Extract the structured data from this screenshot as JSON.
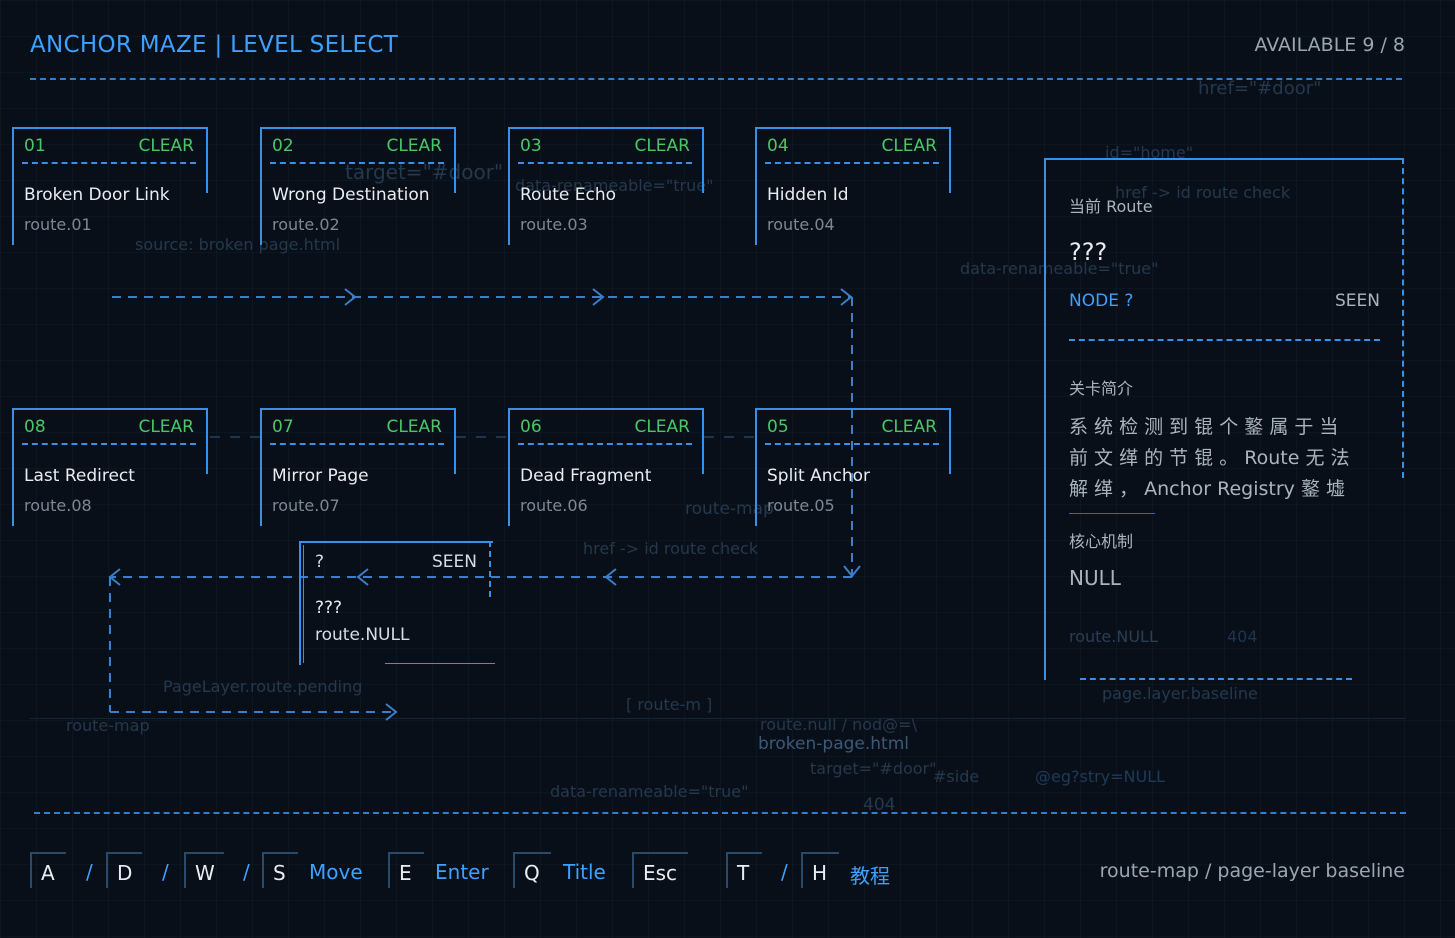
{
  "header": {
    "title": "ANCHOR MAZE | LEVEL SELECT",
    "available": "AVAILABLE 9 / 8"
  },
  "levels_top": [
    {
      "num": "01",
      "status": "CLEAR",
      "name": "Broken Door Link",
      "route": "route.01"
    },
    {
      "num": "02",
      "status": "CLEAR",
      "name": "Wrong Destination",
      "route": "route.02"
    },
    {
      "num": "03",
      "status": "CLEAR",
      "name": "Route Echo",
      "route": "route.03"
    },
    {
      "num": "04",
      "status": "CLEAR",
      "name": "Hidden Id",
      "route": "route.04"
    }
  ],
  "levels_bottom": [
    {
      "num": "08",
      "status": "CLEAR",
      "name": "Last Redirect",
      "route": "route.08"
    },
    {
      "num": "07",
      "status": "CLEAR",
      "name": "Mirror Page",
      "route": "route.07"
    },
    {
      "num": "06",
      "status": "CLEAR",
      "name": "Dead Fragment",
      "route": "route.06"
    },
    {
      "num": "05",
      "status": "CLEAR",
      "name": "Split Anchor",
      "route": "route.05"
    }
  ],
  "hidden_node": {
    "num": "?",
    "status": "SEEN",
    "name": "???",
    "route": "route.NULL"
  },
  "panel": {
    "current_label": "当前 Route",
    "current_value": "???",
    "node": "NODE ?",
    "node_status": "SEEN",
    "intro_label": "关卡简介",
    "intro_line1": "系 统 检 测 到 锟 个 鐜 属 于 当",
    "intro_line2": "前 文 缂 的 节 锟 。 Route 无 法",
    "intro_line3": "解 缂 ， Anchor Registry 鐜 墟",
    "mech_label": "核心机制",
    "mech_value": "NULL",
    "route_ghost": "route.NULL",
    "code_ghost": "404"
  },
  "ghost_text": {
    "g1": "href=\"#door\"",
    "g2": "id=\"home\"",
    "g3": "href -> id route check",
    "g4": "target=\"#door\"",
    "g5": "data-renameable=\"true\"",
    "g6": "source: broken page.html",
    "g7": "data-renameable=\"true\"",
    "g8": "route-map",
    "g9": "href -> id route check",
    "g10": "PageLayer.route.pending",
    "g11": "route-map",
    "g12": "[ route-m ]",
    "g13": "route.null / nod@=\\",
    "g14": "broken-page.html",
    "g15": "target=\"#door\"",
    "g16": "#side",
    "g17": "@eg?stry=NULL",
    "g18": "data-renameable=\"true\"",
    "g19": "404",
    "g20": "page.layer.baseline"
  },
  "controls": {
    "key_a": "A",
    "key_d": "D",
    "key_w": "W",
    "key_s": "S",
    "sep": "/",
    "move": "Move",
    "key_e": "E",
    "enter": "Enter",
    "key_q": "Q",
    "title": "Title",
    "key_esc": "Esc",
    "key_t": "T",
    "key_h": "H",
    "tutorial": "教程",
    "footer": "route-map / page-layer baseline"
  },
  "colors": {
    "accent": "#3ea0ff",
    "clear": "#49c765",
    "frame": "#3890e8",
    "background": "#080f18"
  }
}
